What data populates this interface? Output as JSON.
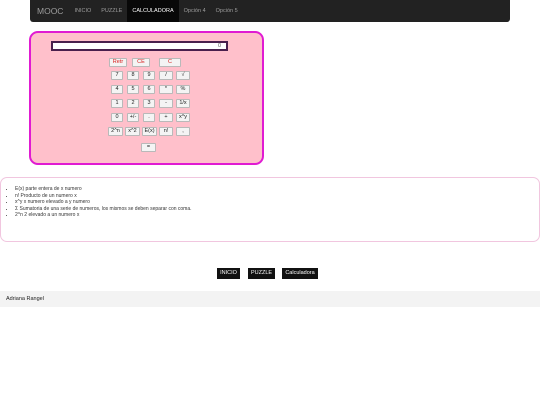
{
  "nav": {
    "brand": "MOOC",
    "items": [
      "INICIO",
      "PUZZLE",
      "CALCULADORA",
      "Opción 4",
      "Opción 5"
    ],
    "active_index": 2
  },
  "calculator": {
    "display_value": "0",
    "rows": [
      [
        "Retr",
        "CE",
        "C"
      ],
      [
        "7",
        "8",
        "9",
        "/",
        "√"
      ],
      [
        "4",
        "5",
        "6",
        "*",
        "%"
      ],
      [
        "1",
        "2",
        "3",
        "-",
        "1/x"
      ],
      [
        "0",
        "+/-",
        ".",
        "+",
        "x^y"
      ],
      [
        "2^n",
        "x^2",
        "E(x)",
        "n!",
        ","
      ],
      [
        "="
      ]
    ]
  },
  "help": {
    "items": [
      "E(x) parte entera de x numero",
      "n! Producto de un numero x",
      "x^y x numero elevado a y numero",
      "Σ Sumatoria de una serie de numeros, los mismos se deben separar con coma.",
      "2^n 2 elevado a un numero x"
    ]
  },
  "bottom_nav": [
    "INICIO",
    "PUZZLE",
    "Calculadora"
  ],
  "footer": {
    "author": "Adriana Rangel"
  },
  "colors": {
    "calc_bg": "#ffc0cb",
    "calc_border": "#e01bd2",
    "navbar": "#222222",
    "clear_keys": "#d81b1b"
  }
}
